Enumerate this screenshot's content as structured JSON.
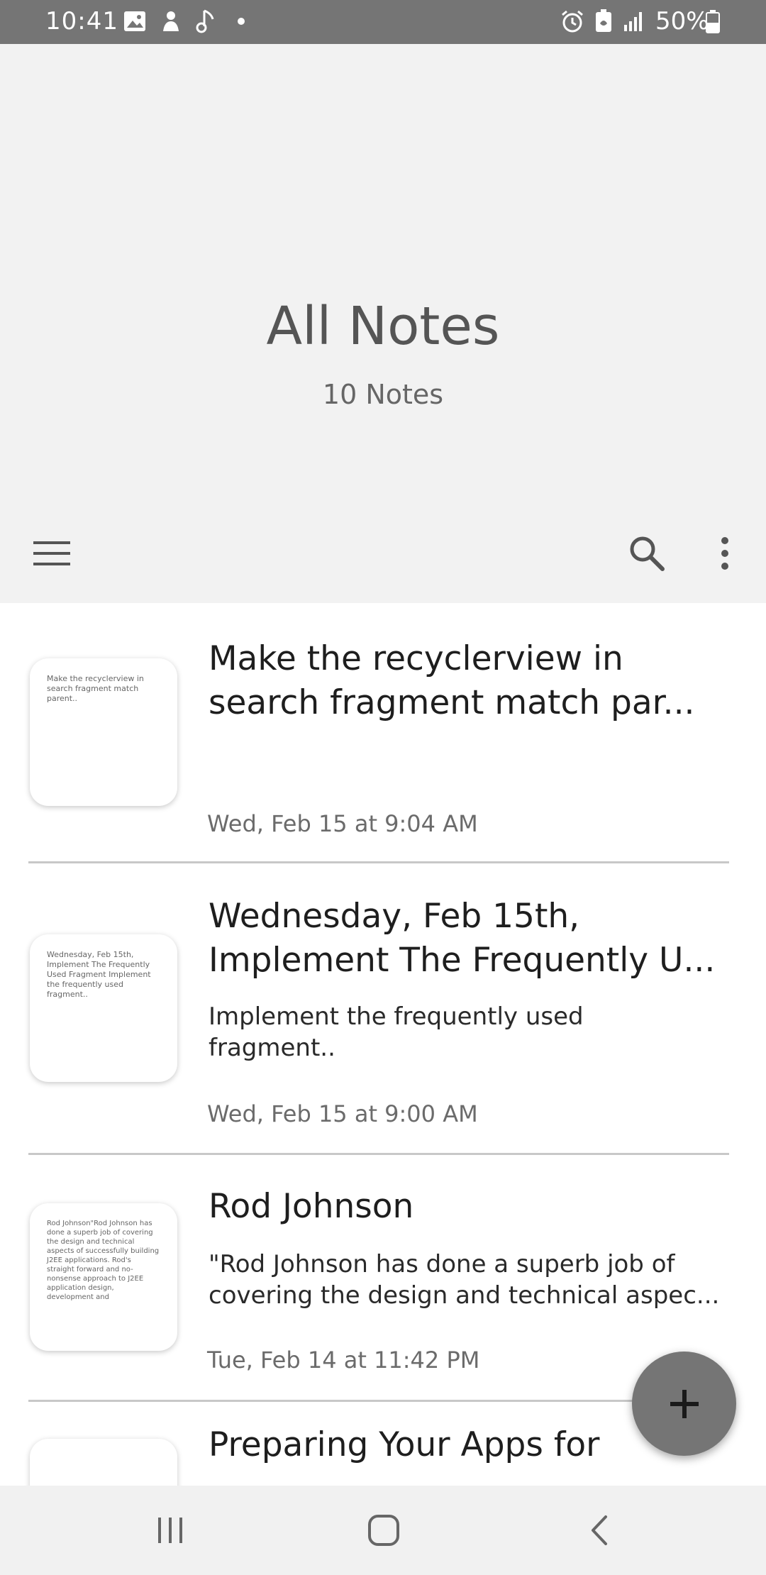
{
  "status_bar": {
    "time": "10:41",
    "icons": [
      "image-icon",
      "upload-icon",
      "music-note-icon",
      "dot-icon",
      "alarm-icon",
      "battery-saver-icon",
      "signal-icon",
      "battery-icon"
    ],
    "battery": "50%"
  },
  "header": {
    "title": "All Notes",
    "subtitle": "10 Notes"
  },
  "toolbar": {
    "menu_icon": "menu-icon",
    "search_icon": "search-icon",
    "more_icon": "more-vert-icon"
  },
  "notes": [
    {
      "thumb": "Make the recyclerview in search fragment match parent..",
      "title_line1": "Make the recyclerview in",
      "title_line2": "search fragment match par...",
      "body_line1": "",
      "body_line2": "",
      "date": "Wed, Feb 15 at 9:04 AM"
    },
    {
      "thumb": "Wednesday, Feb 15th, Implement The Frequently Used Fragment Implement the frequently used fragment..",
      "title_line1": "Wednesday, Feb 15th,",
      "title_line2": "Implement The Frequently U...",
      "body_line1": "Implement the frequently used",
      "body_line2": "fragment..",
      "date": "Wed, Feb 15 at 9:00 AM"
    },
    {
      "thumb": "Rod Johnson\"Rod Johnson has done a superb job of covering the design and technical aspects of successfully building J2EE applications. Rod's straight forward and no-nonsense approach to J2EE application design, development and",
      "title_line1": "Rod Johnson",
      "title_line2": "",
      "body_line1": "\"Rod Johnson has done a superb job of",
      "body_line2": "covering the design and technical aspec...",
      "date": "Tue, Feb 14 at 11:42 PM"
    },
    {
      "thumb": "",
      "title_line1": "Preparing Your Apps for",
      "title_line2": "",
      "body_line1": "",
      "body_line2": "",
      "date": ""
    }
  ],
  "fab": {
    "icon": "plus-icon"
  },
  "nav_bar": {
    "recents_icon": "recents-icon",
    "home_icon": "home-icon",
    "back_icon": "back-icon"
  },
  "colors": {
    "status_bar": "#757575",
    "header_bg": "#f2f2f2",
    "fab": "#757575",
    "nav_bg": "#f1f1f1"
  }
}
